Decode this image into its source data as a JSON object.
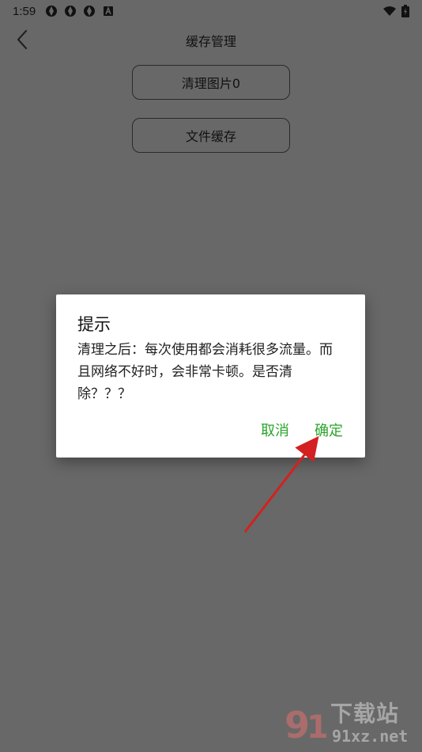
{
  "status_bar": {
    "time": "1:59",
    "left_icons": [
      "photos-icon",
      "photos-icon",
      "photos-icon",
      "a-icon"
    ],
    "right_icons": [
      "wifi-icon",
      "battery-charging-icon"
    ]
  },
  "appbar": {
    "title": "缓存管理",
    "back_icon": "chevron-left-icon"
  },
  "buttons": {
    "clear_images": "清理图片0",
    "file_cache": "文件缓存"
  },
  "dialog": {
    "title": "提示",
    "message": "清理之后：每次使用都会消耗很多流量。而且网络不好时，会非常卡顿。是否清除？？？",
    "cancel_label": "取消",
    "confirm_label": "确定"
  },
  "annotation": {
    "arrow_color": "#d42020"
  },
  "watermark": {
    "name": "下载站",
    "url": "91xz.net"
  },
  "colors": {
    "overlay_background": "#686868",
    "dialog_background": "#ffffff",
    "accent": "#2aa52a"
  }
}
